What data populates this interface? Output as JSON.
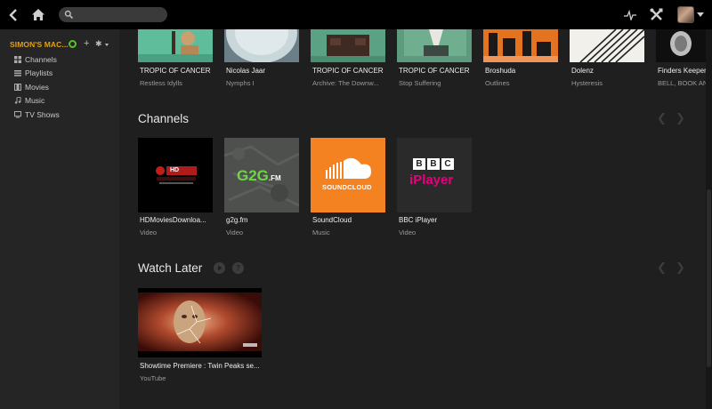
{
  "sidebar": {
    "server_name": "SIMON'S MAC...",
    "items": [
      {
        "label": "Channels",
        "icon": "grid-icon"
      },
      {
        "label": "Playlists",
        "icon": "list-icon"
      },
      {
        "label": "Movies",
        "icon": "film-icon"
      },
      {
        "label": "Music",
        "icon": "music-note-icon"
      },
      {
        "label": "TV Shows",
        "icon": "tv-icon"
      }
    ]
  },
  "albums": [
    {
      "title": "TROPIC OF CANCER",
      "subtitle": "Restless Idylls"
    },
    {
      "title": "Nicolas Jaar",
      "subtitle": "Nymphs I"
    },
    {
      "title": "TROPIC OF CANCER",
      "subtitle": "Archive: The Downw..."
    },
    {
      "title": "TROPIC OF CANCER",
      "subtitle": "Stop Suffering"
    },
    {
      "title": "Broshuda",
      "subtitle": "Outlines"
    },
    {
      "title": "Dolenz",
      "subtitle": "Hysteresis"
    },
    {
      "title": "Finders Keeper",
      "subtitle": "BELL, BOOK AN"
    }
  ],
  "channels": {
    "title": "Channels",
    "items": [
      {
        "title": "HDMoviesDownloa...",
        "subtitle": "Video",
        "logo_text": "HD"
      },
      {
        "title": "g2g.fm",
        "subtitle": "Video",
        "logo_main": "G2G",
        "logo_suffix": ".FM"
      },
      {
        "title": "SoundCloud",
        "subtitle": "Music",
        "logo_text": "SOUNDCLOUD"
      },
      {
        "title": "BBC iPlayer",
        "subtitle": "Video",
        "logo_letters": [
          "B",
          "B",
          "C"
        ],
        "logo_text": "iPlayer"
      }
    ]
  },
  "watch_later": {
    "title": "Watch Later",
    "items": [
      {
        "title": "Showtime Premiere : Twin Peaks se...",
        "subtitle": "YouTube"
      }
    ]
  },
  "colors": {
    "accent": "#e5a00d",
    "soundcloud": "#f26f23",
    "g2g_green": "#6cd644",
    "bbc_pink": "#e6007e"
  }
}
